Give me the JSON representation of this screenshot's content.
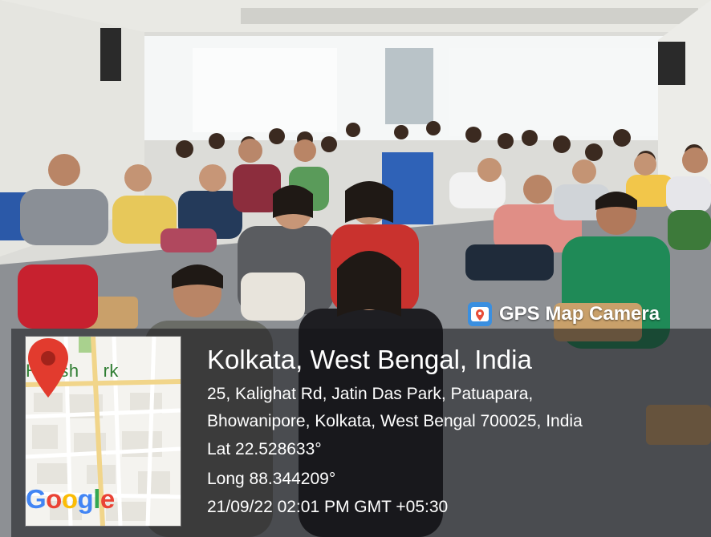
{
  "app_badge": {
    "title": "GPS Map Camera",
    "icon": "gps-map-camera-icon"
  },
  "map": {
    "place_label": "Harish",
    "place_label_tail": "rk",
    "pin_color": "#E23B2E",
    "logo": {
      "g1": "G",
      "o1": "o",
      "o2": "o",
      "g2": "g",
      "l": "l",
      "e": "e"
    }
  },
  "location": {
    "city": "Kolkata, West Bengal, India",
    "address_line1": "25, Kalighat Rd, Jatin Das Park, Patuapara,",
    "address_line2": "Bhowanipore, Kolkata, West Bengal 700025, India",
    "latitude": "Lat 22.528633°",
    "longitude": "Long 88.344209°",
    "datetime": "21/09/22 02:01 PM GMT +05:30"
  }
}
